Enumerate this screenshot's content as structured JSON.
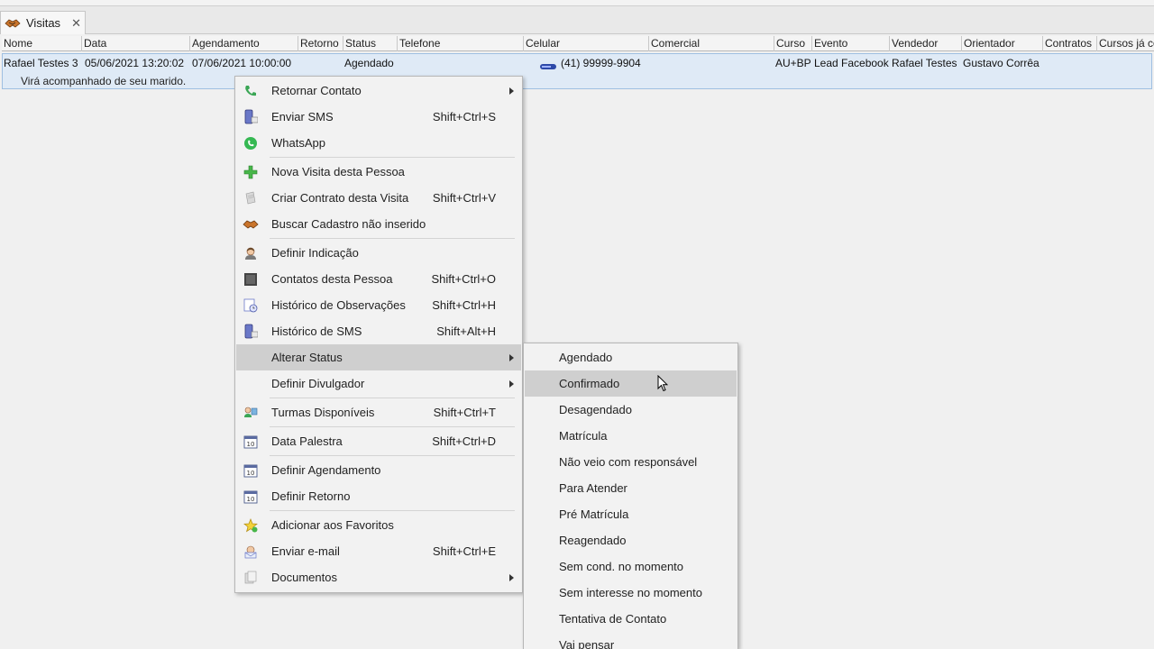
{
  "tab": {
    "title": "Visitas",
    "close_glyph": "✕",
    "icon": "handshake-icon"
  },
  "grid": {
    "columns": [
      "Nome",
      "Data",
      "Agendamento",
      "Retorno",
      "Status",
      "Telefone",
      "Celular",
      "Comercial",
      "Curso",
      "Evento",
      "Vendedor",
      "Orientador",
      "Contratos",
      "Cursos já co"
    ],
    "row": {
      "nome": "Rafael Testes 3",
      "data": "05/06/2021 13:20:02",
      "agendamento": "07/06/2021 10:00:00",
      "status": "Agendado",
      "celular": "(41) 99999-9904",
      "curso": "AU+BP",
      "evento": "Lead Facebook",
      "vendedor": "Rafael Testes",
      "orientador": "Gustavo Corrêa",
      "observacao": "Virá acompanhado de seu marido."
    }
  },
  "context_menu": {
    "items": [
      {
        "label": "Retornar Contato",
        "shortcut": "",
        "submenu": true,
        "icon": "phone-icon"
      },
      {
        "label": "Enviar SMS",
        "shortcut": "Shift+Ctrl+S",
        "submenu": false,
        "icon": "sms-icon"
      },
      {
        "label": "WhatsApp",
        "shortcut": "",
        "submenu": false,
        "icon": "whatsapp-icon"
      },
      {
        "label": "Nova Visita desta Pessoa",
        "shortcut": "",
        "submenu": false,
        "icon": "plus-icon"
      },
      {
        "label": "Criar Contrato desta Visita",
        "shortcut": "Shift+Ctrl+V",
        "submenu": false,
        "icon": "contract-icon"
      },
      {
        "label": "Buscar Cadastro não inserido",
        "shortcut": "",
        "submenu": false,
        "icon": "handshake-icon"
      },
      {
        "label": "Definir Indicação",
        "shortcut": "",
        "submenu": false,
        "icon": "person-icon"
      },
      {
        "label": "Contatos desta Pessoa",
        "shortcut": "Shift+Ctrl+O",
        "submenu": false,
        "icon": "contacts-icon"
      },
      {
        "label": "Histórico de Observações",
        "shortcut": "Shift+Ctrl+H",
        "submenu": false,
        "icon": "notes-history-icon"
      },
      {
        "label": "Histórico de SMS",
        "shortcut": "Shift+Alt+H",
        "submenu": false,
        "icon": "sms-history-icon"
      },
      {
        "label": "Alterar Status",
        "shortcut": "",
        "submenu": true,
        "icon": ""
      },
      {
        "label": "Definir Divulgador",
        "shortcut": "",
        "submenu": true,
        "icon": ""
      },
      {
        "label": "Turmas Disponíveis",
        "shortcut": "Shift+Ctrl+T",
        "submenu": false,
        "icon": "class-icon"
      },
      {
        "label": "Data Palestra",
        "shortcut": "Shift+Ctrl+D",
        "submenu": false,
        "icon": "calendar-icon"
      },
      {
        "label": "Definir Agendamento",
        "shortcut": "",
        "submenu": false,
        "icon": "calendar-icon"
      },
      {
        "label": "Definir Retorno",
        "shortcut": "",
        "submenu": false,
        "icon": "calendar-icon"
      },
      {
        "label": "Adicionar aos Favoritos",
        "shortcut": "",
        "submenu": false,
        "icon": "star-icon"
      },
      {
        "label": "Enviar e-mail",
        "shortcut": "Shift+Ctrl+E",
        "submenu": false,
        "icon": "email-icon"
      },
      {
        "label": "Documentos",
        "shortcut": "",
        "submenu": true,
        "icon": "documents-icon"
      }
    ]
  },
  "status_submenu": {
    "items": [
      "Agendado",
      "Confirmado",
      "Desagendado",
      "Matrícula",
      "Não veio com responsável",
      "Para Atender",
      "Pré Matrícula",
      "Reagendado",
      "Sem cond. no momento",
      "Sem interesse no momento",
      "Tentativa de Contato",
      "Vai pensar"
    ]
  },
  "colors": {
    "row_selected": "#dfeaf6",
    "menu_highlight": "#cfcfcf",
    "accent_green": "#3aa655"
  }
}
